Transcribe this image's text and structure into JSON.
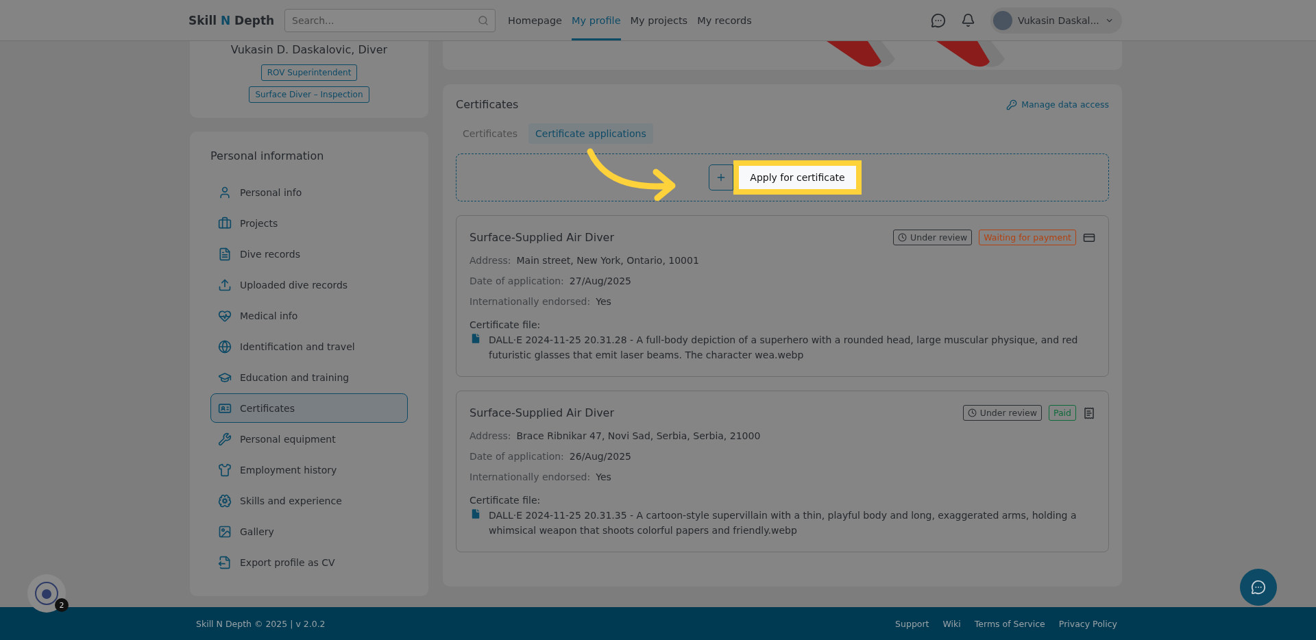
{
  "header": {
    "logo": {
      "before": "Skill ",
      "accent": "N",
      "after": " Depth"
    },
    "search": {
      "placeholder": "Search..."
    },
    "nav": [
      {
        "label": "Homepage",
        "selected": false
      },
      {
        "label": "My profile",
        "selected": true
      },
      {
        "label": "My projects",
        "selected": false
      },
      {
        "label": "My records",
        "selected": false
      }
    ],
    "user": {
      "name": "Vukasin Daskal..."
    }
  },
  "profile": {
    "name": "Vukasin D. Daskalovic, Diver",
    "roles": [
      "ROV Superintendent",
      "Surface Diver – Inspection"
    ]
  },
  "sidebar": {
    "title": "Personal information",
    "items": [
      {
        "label": "Personal info",
        "selected": false
      },
      {
        "label": "Projects",
        "selected": false
      },
      {
        "label": "Dive records",
        "selected": false
      },
      {
        "label": "Uploaded dive records",
        "selected": false
      },
      {
        "label": "Medical info",
        "selected": false
      },
      {
        "label": "Identification and travel",
        "selected": false
      },
      {
        "label": "Education and training",
        "selected": false
      },
      {
        "label": "Certificates",
        "selected": true
      },
      {
        "label": "Personal equipment",
        "selected": false
      },
      {
        "label": "Employment history",
        "selected": false
      },
      {
        "label": "Skills and experience",
        "selected": false
      },
      {
        "label": "Gallery",
        "selected": false
      },
      {
        "label": "Export profile as CV",
        "selected": false
      }
    ]
  },
  "certificates": {
    "title": "Certificates",
    "manage_link": "Manage data access",
    "tabs": [
      {
        "label": "Certificates",
        "selected": false
      },
      {
        "label": "Certificate applications",
        "selected": true
      }
    ],
    "apply_button": "Apply for certificate",
    "applications": [
      {
        "title": "Surface-Supplied Air Diver",
        "badges": [
          {
            "label": "Under review",
            "kind": "review"
          },
          {
            "label": "Waiting for payment",
            "kind": "waiting"
          }
        ],
        "fields": [
          {
            "label": "Address:",
            "value": "Main street, New York, Ontario, 10001"
          },
          {
            "label": "Date of application:",
            "value": "27/Aug/2025"
          },
          {
            "label": "Internationally endorsed:",
            "value": "Yes"
          }
        ],
        "file_label": "Certificate file:",
        "file": "DALL·E 2024-11-25 20.31.28 - A full-body depiction of a superhero with a rounded head, large muscular physique, and red futuristic glasses that emit laser beams. The character wea.webp"
      },
      {
        "title": "Surface-Supplied Air Diver",
        "badges": [
          {
            "label": "Under review",
            "kind": "review"
          },
          {
            "label": "Paid",
            "kind": "paid"
          }
        ],
        "fields": [
          {
            "label": "Address:",
            "value": "Brace Ribnikar 47, Novi Sad, Serbia, Serbia, 21000"
          },
          {
            "label": "Date of application:",
            "value": "26/Aug/2025"
          },
          {
            "label": "Internationally endorsed:",
            "value": "Yes"
          }
        ],
        "file_label": "Certificate file:",
        "file": "DALL·E 2024-11-25 20.31.35 - A cartoon-style supervillain with a thin, playful body and long, exaggerated arms, holding a whimsical weapon that shoots colorful papers and friendly.webp"
      }
    ]
  },
  "footer": {
    "copyright": "Skill N Depth © 2025 | v 2.0.2",
    "links": [
      "Support",
      "Wiki",
      "Terms of Service",
      "Privacy Policy"
    ]
  },
  "notification_badge": "2"
}
